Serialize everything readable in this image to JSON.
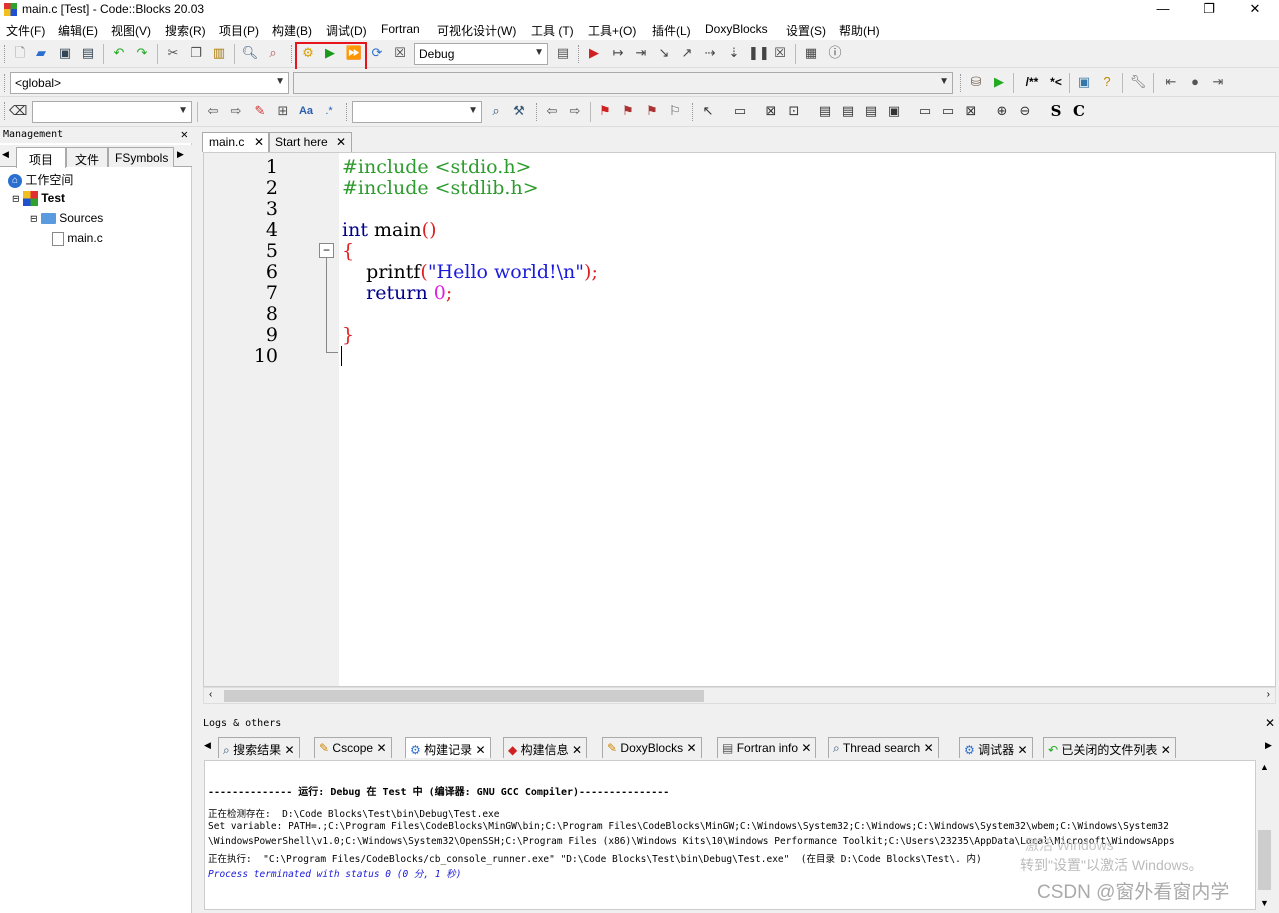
{
  "window": {
    "title": "main.c [Test] - Code::Blocks 20.03",
    "minimize": "—",
    "maximize": "❐",
    "close": "✕"
  },
  "menubar": [
    "文件(F)",
    "编辑(E)",
    "视图(V)",
    "搜索(R)",
    "项目(P)",
    "构建(B)",
    "调试(D)",
    "Fortran",
    "可视化设计(W)",
    "工具 (T)",
    "工具+(O)",
    "插件(L)",
    "DoxyBlocks",
    "设置(S)",
    "帮助(H)"
  ],
  "toolbar": {
    "build_target": "Debug",
    "scope": "<global>",
    "doc_comment": "/**",
    "line_comment": "*<",
    "regex": ".*",
    "bold_s": "S",
    "bold_c": "C"
  },
  "management": {
    "header": "Management",
    "tabs": [
      "项目",
      "文件",
      "FSymbols"
    ],
    "tree": {
      "workspace": "工作空间",
      "project": "Test",
      "folder": "Sources",
      "file": "main.c"
    }
  },
  "editor": {
    "tabs": [
      "main.c",
      "Start here"
    ],
    "line_numbers": [
      "1",
      "2",
      "3",
      "4",
      "5",
      "6",
      "7",
      "8",
      "9",
      "10"
    ],
    "code": {
      "l1": "#include <stdio.h>",
      "l2": "#include <stdlib.h>",
      "l4_kw": "int",
      "l4_rest": " main",
      "l4_paren": "()",
      "l5": "{",
      "l6_fn": "    printf",
      "l6_open": "(",
      "l6_str": "\"Hello world!\\n\"",
      "l6_close": ");",
      "l7_kw": "    return",
      "l7_num": " 0",
      "l7_semi": ";",
      "l9": "}"
    }
  },
  "logs": {
    "header": "Logs & others",
    "tabs": [
      "搜索结果",
      "Cscope",
      "构建记录",
      "构建信息",
      "DoxyBlocks",
      "Fortran info",
      "Thread search",
      "调试器",
      "已关闭的文件列表"
    ],
    "lines": [
      "-------------- 运行: Debug 在 Test 中 (编译器: GNU GCC Compiler)---------------",
      "正在检测存在:  D:\\Code Blocks\\Test\\bin\\Debug\\Test.exe",
      "Set variable: PATH=.;C:\\Program Files\\CodeBlocks\\MinGW\\bin;C:\\Program Files\\CodeBlocks\\MinGW;C:\\Windows\\System32;C:\\Windows;C:\\Windows\\System32\\wbem;C:\\Windows\\System32",
      "\\WindowsPowerShell\\v1.0;C:\\Windows\\System32\\OpenSSH;C:\\Program Files (x86)\\Windows Kits\\10\\Windows Performance Toolkit;C:\\Users\\23235\\AppData\\Local\\Microsoft\\WindowsApps",
      "正在执行:  \"C:\\Program Files/CodeBlocks/cb_console_runner.exe\" \"D:\\Code Blocks\\Test\\bin\\Debug\\Test.exe\"  (在目录 D:\\Code Blocks\\Test\\. 内)",
      "Process terminated with status 0 (0 分, 1 秒)"
    ]
  },
  "overlay": {
    "activation": "转到\"设置\"以激活 Windows。",
    "activation_title": "激活 Windows",
    "watermark": "CSDN @窗外看窗内学"
  },
  "colors": {
    "highlight_box": "#e8141c",
    "change_bar": "#22dd44",
    "preprocessor": "#2e9b2e",
    "keyword": "#00008b",
    "string": "#1a1adb"
  }
}
